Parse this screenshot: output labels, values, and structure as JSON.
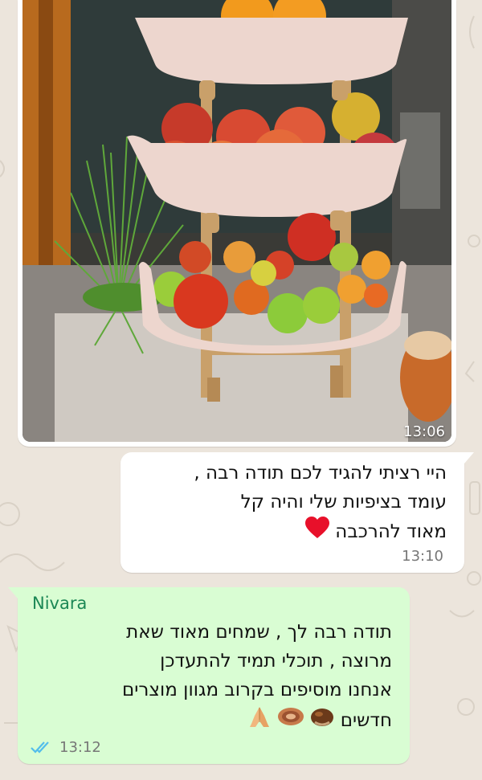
{
  "colors": {
    "chat_background": "#ece5dc",
    "incoming_bubble": "#ffffff",
    "outgoing_bubble": "#d9fdd3",
    "sender_name": "#1b8755",
    "read_ticks": "#53bdeb"
  },
  "image_message": {
    "time": "13:06"
  },
  "incoming_message": {
    "lines": [
      "היי רציתי להגיד לכם תודה רבה ,",
      "עומד בציפיות שלי והיה קל",
      "מאוד להרכבה"
    ],
    "emoji": "red-heart-icon",
    "time": "13:10"
  },
  "outgoing_message": {
    "sender": "Nivara",
    "lines": [
      "תודה רבה לך , שמחים מאוד שאת",
      "מרוצה , תוכלי תמיד להתעדכן",
      "אנחנו מוסיפים בקרוב מגוון מוצרים",
      "חדשים"
    ],
    "emojis": [
      "chestnut-icon",
      "bread-icon",
      "folded-hands-icon"
    ],
    "time": "13:12",
    "status": "read-double-check-icon"
  }
}
